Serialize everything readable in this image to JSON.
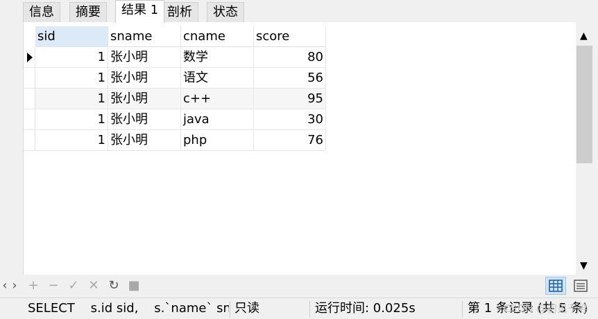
{
  "tabs": [
    "信息",
    "摘要",
    "结果 1",
    "剖析",
    "状态"
  ],
  "active_tab": "结果 1",
  "grid": {
    "columns": [
      "sid",
      "sname",
      "cname",
      "score"
    ],
    "rows": [
      [
        "1",
        "张小明",
        "数学",
        "80"
      ],
      [
        "1",
        "张小明",
        "语文",
        "56"
      ],
      [
        "1",
        "张小明",
        "c++",
        "95"
      ],
      [
        "1",
        "张小明",
        "java",
        "30"
      ],
      [
        "1",
        "张小明",
        "php",
        "76"
      ]
    ]
  },
  "toolbar": {
    "nav_left": "‹",
    "nav_right": "›",
    "add": "+",
    "remove": "−",
    "apply": "✓",
    "cancel": "✕",
    "refresh": "↻",
    "stop": "■"
  },
  "status": {
    "sql": "SELECT    s.id sid,    s.`name` snan",
    "mode": "只读",
    "runtime": "运行时间: 0.025s",
    "record": "第 1 条记录 (共 5 条)",
    "watermark": "CSDN @初见千寻"
  },
  "colors": {
    "header_selected": "#dce9f7",
    "view_active": "#cfe4f7"
  }
}
